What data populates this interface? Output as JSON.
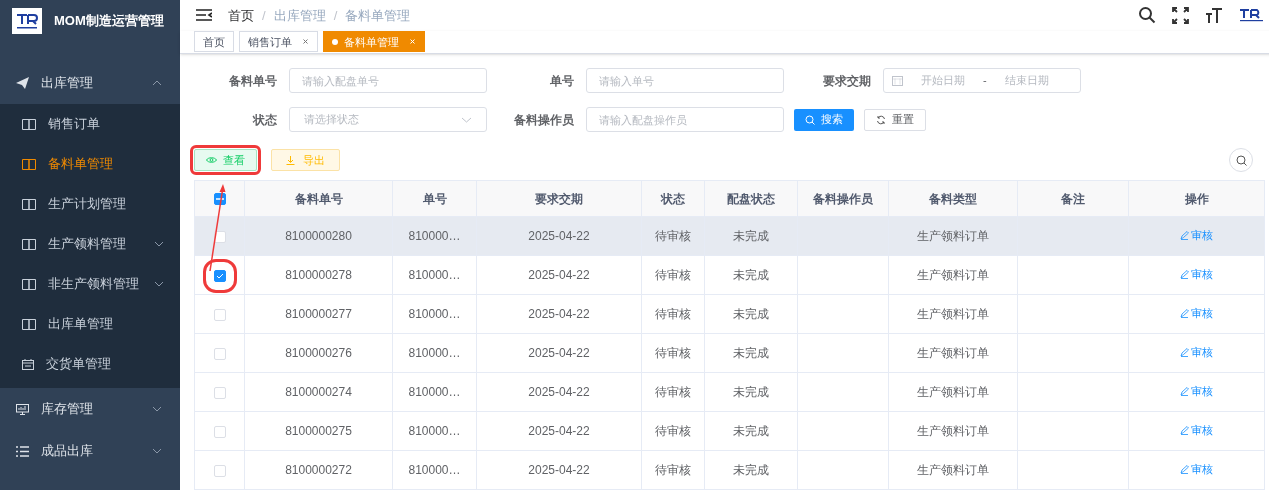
{
  "app": {
    "title": "MOM制造运营管理"
  },
  "sidebar": {
    "items": [
      {
        "label": "出库管理",
        "expanded": true,
        "children": [
          {
            "label": "销售订单",
            "selected": false
          },
          {
            "label": "备料单管理",
            "selected": true
          },
          {
            "label": "生产计划管理",
            "selected": false
          },
          {
            "label": "生产领料管理",
            "selected": false,
            "has_children": true
          },
          {
            "label": "非生产领料管理",
            "selected": false,
            "has_children": true
          },
          {
            "label": "出库单管理",
            "selected": false
          },
          {
            "label": "交货单管理",
            "selected": false
          }
        ]
      },
      {
        "label": "库存管理",
        "expanded": false
      },
      {
        "label": "成品出库",
        "expanded": false
      }
    ]
  },
  "breadcrumb": {
    "separator": "/",
    "items": [
      "首页",
      "出库管理",
      "备料单管理"
    ]
  },
  "tabs": [
    {
      "label": "首页",
      "selected": false,
      "closable": false
    },
    {
      "label": "销售订单",
      "selected": false,
      "closable": true
    },
    {
      "label": "备料单管理",
      "selected": true,
      "closable": true
    }
  ],
  "filters": [
    {
      "label": "备料单号",
      "placeholder": "请输入配盘单号",
      "kind": "text"
    },
    {
      "label": "单号",
      "placeholder": "请输入单号",
      "kind": "text"
    },
    {
      "label": "要求交期",
      "kind": "daterange",
      "start_placeholder": "开始日期",
      "separator": "-",
      "end_placeholder": "结束日期"
    },
    {
      "label": "状态",
      "placeholder": "请选择状态",
      "kind": "select"
    },
    {
      "label": "备料操作员",
      "placeholder": "请输入配盘操作员",
      "kind": "text"
    }
  ],
  "search_button": "搜索",
  "reset_button": "重置",
  "toolbar": [
    {
      "label": "查看",
      "kind": "view"
    },
    {
      "label": "导出",
      "kind": "export"
    }
  ],
  "table": {
    "header_checkbox": {
      "indeterminate": true
    },
    "columns": [
      "备料单号",
      "单号",
      "要求交期",
      "状态",
      "配盘状态",
      "备料操作员",
      "备料类型",
      "备注",
      "操作"
    ],
    "rows": [
      {
        "checked": false,
        "hovered": true,
        "cells": [
          "8100000280",
          "810000…",
          "2025-04-22",
          "待审核",
          "未完成",
          "",
          "生产领料订单",
          ""
        ],
        "action": "审核"
      },
      {
        "checked": true,
        "hovered": false,
        "cells": [
          "8100000278",
          "810000…",
          "2025-04-22",
          "待审核",
          "未完成",
          "",
          "生产领料订单",
          ""
        ],
        "action": "审核"
      },
      {
        "checked": false,
        "hovered": false,
        "cells": [
          "8100000277",
          "810000…",
          "2025-04-22",
          "待审核",
          "未完成",
          "",
          "生产领料订单",
          ""
        ],
        "action": "审核"
      },
      {
        "checked": false,
        "hovered": false,
        "cells": [
          "8100000276",
          "810000…",
          "2025-04-22",
          "待审核",
          "未完成",
          "",
          "生产领料订单",
          ""
        ],
        "action": "审核"
      },
      {
        "checked": false,
        "hovered": false,
        "cells": [
          "8100000274",
          "810000…",
          "2025-04-22",
          "待审核",
          "未完成",
          "",
          "生产领料订单",
          ""
        ],
        "action": "审核"
      },
      {
        "checked": false,
        "hovered": false,
        "cells": [
          "8100000275",
          "810000…",
          "2025-04-22",
          "待审核",
          "未完成",
          "",
          "生产领料订单",
          ""
        ],
        "action": "审核"
      },
      {
        "checked": false,
        "hovered": false,
        "cells": [
          "8100000272",
          "810000…",
          "2025-04-22",
          "待审核",
          "未完成",
          "",
          "生产领料订单",
          ""
        ],
        "action": "审核"
      }
    ]
  }
}
